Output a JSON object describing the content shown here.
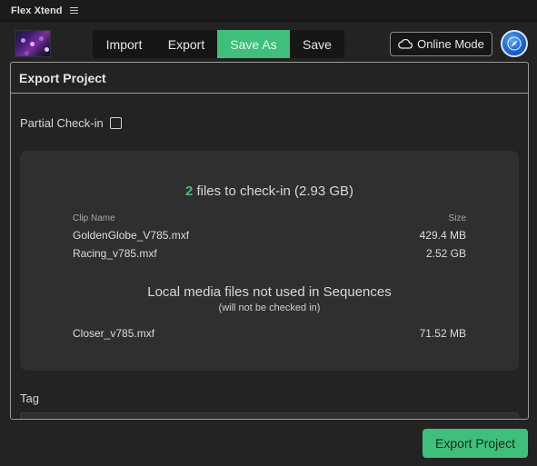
{
  "app": {
    "title": "Flex Xtend"
  },
  "tabs": [
    {
      "label": "Import"
    },
    {
      "label": "Export"
    },
    {
      "label": "Save As",
      "active": true
    },
    {
      "label": "Save"
    }
  ],
  "online_mode": {
    "label": "Online Mode",
    "icon": "cloud-icon"
  },
  "panel": {
    "title": "Export Project",
    "partial_checkin": {
      "label": "Partial Check-in",
      "checked": false
    },
    "summary": {
      "count": "2",
      "text": " files to check-in (2.93 GB)"
    },
    "columns": {
      "name": "Clip Name",
      "size": "Size"
    },
    "files": [
      {
        "name": "GoldenGlobe_V785.mxf",
        "size": "429.4 MB"
      },
      {
        "name": "Racing_v785.mxf",
        "size": "2.52 GB"
      }
    ],
    "local_media": {
      "title": "Local media files not used in Sequences",
      "subtitle": "(will not be checked in)",
      "files": [
        {
          "name": "Closer_v785.mxf",
          "size": "71.52 MB"
        }
      ]
    },
    "tag": {
      "label": "Tag",
      "value": "",
      "placeholder": ""
    }
  },
  "export_button": {
    "label": "Export Project"
  },
  "colors": {
    "accent": "#3fc07a",
    "background": "#232323",
    "card": "#2f2f2f",
    "titlebar": "#1b1b1b"
  }
}
